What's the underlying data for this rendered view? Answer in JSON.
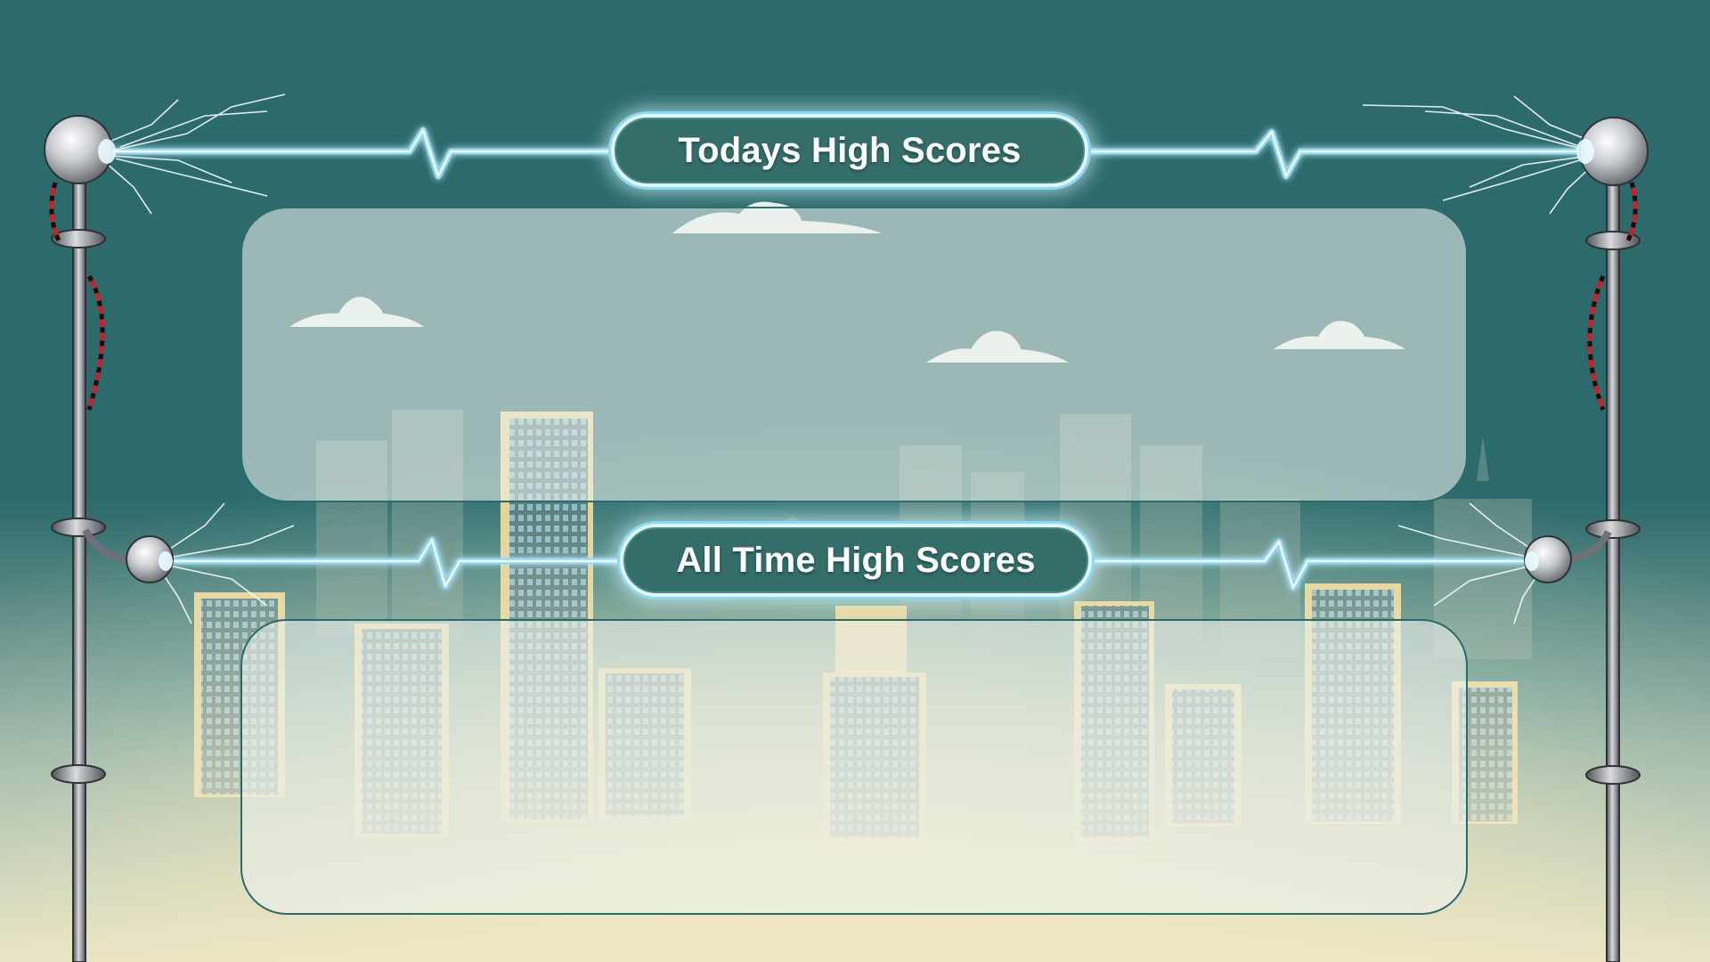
{
  "screen": "high-scores",
  "todays": {
    "title": "Todays High Scores",
    "entries": []
  },
  "all_time": {
    "title": "All Time High Scores",
    "entries": []
  },
  "colors": {
    "title_fill": "#336e6b",
    "title_border": "#dff6ff",
    "electric_glow": "#8fd8f2",
    "panel_border": "#2b6a6a",
    "pole": "#6e7278",
    "wire_red": "#c8232c"
  },
  "icons": [
    "tesla-coil-sphere-icon",
    "lightning-arc-icon",
    "cloud-icon",
    "city-skyline"
  ]
}
